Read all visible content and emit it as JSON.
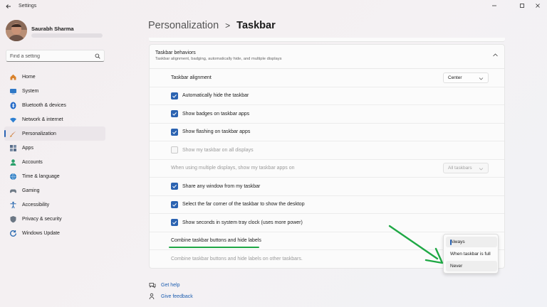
{
  "window": {
    "title": "Settings",
    "back_icon": "back-arrow-icon",
    "controls": [
      "minimize-icon",
      "maximize-icon",
      "close-icon"
    ]
  },
  "profile": {
    "name": "Saurabh Sharma"
  },
  "search": {
    "placeholder": "Find a setting",
    "icon": "search-icon"
  },
  "nav": {
    "items": [
      {
        "label": "Home",
        "icon": "home-icon",
        "color": "#d9822b"
      },
      {
        "label": "System",
        "icon": "system-icon",
        "color": "#2f78c6"
      },
      {
        "label": "Bluetooth & devices",
        "icon": "bluetooth-icon",
        "color": "#1f67c7"
      },
      {
        "label": "Network & internet",
        "icon": "wifi-icon",
        "color": "#2d7fd1"
      },
      {
        "label": "Personalization",
        "icon": "brush-icon",
        "color": "#c86a2b",
        "selected": true
      },
      {
        "label": "Apps",
        "icon": "apps-icon",
        "color": "#5a6f8a"
      },
      {
        "label": "Accounts",
        "icon": "accounts-icon",
        "color": "#2aa06b"
      },
      {
        "label": "Time & language",
        "icon": "globe-icon",
        "color": "#2f7fc4"
      },
      {
        "label": "Gaming",
        "icon": "gaming-icon",
        "color": "#6e7a86"
      },
      {
        "label": "Accessibility",
        "icon": "accessibility-icon",
        "color": "#2a6ab0"
      },
      {
        "label": "Privacy & security",
        "icon": "shield-icon",
        "color": "#6b7784"
      },
      {
        "label": "Windows Update",
        "icon": "update-icon",
        "color": "#2a6ab0"
      }
    ]
  },
  "breadcrumb": {
    "parent": "Personalization",
    "separator": ">",
    "current": "Taskbar"
  },
  "section": {
    "title": "Taskbar behaviors",
    "subtitle": "Taskbar alignment, badging, automatically hide, and multiple displays"
  },
  "settings": {
    "alignment": {
      "label": "Taskbar alignment",
      "value": "Center"
    },
    "auto_hide": {
      "label": "Automatically hide the taskbar",
      "checked": true
    },
    "badges": {
      "label": "Show badges on taskbar apps",
      "checked": true
    },
    "flashing": {
      "label": "Show flashing on taskbar apps",
      "checked": true
    },
    "all_displays": {
      "label": "Show my taskbar on all displays",
      "checked": false,
      "disabled": true
    },
    "multi_display": {
      "label": "When using multiple displays, show my taskbar apps on",
      "value": "All taskbars",
      "disabled": true
    },
    "share_window": {
      "label": "Share any window from my taskbar",
      "checked": true
    },
    "far_corner": {
      "label": "Select the far corner of the taskbar to show the desktop",
      "checked": true
    },
    "seconds": {
      "label": "Show seconds in system tray clock (uses more power)",
      "checked": true
    },
    "combine": {
      "label": "Combine taskbar buttons and hide labels"
    },
    "combine_other": {
      "label": "Combine taskbar buttons and hide labels on other taskbars.",
      "disabled": true
    }
  },
  "combine_menu": {
    "options": [
      "Always",
      "When taskbar is full",
      "Never"
    ],
    "selected": "Always",
    "hovered": "Never"
  },
  "links": {
    "help": "Get help",
    "feedback": "Give feedback"
  },
  "colors": {
    "accent": "#2b63b1",
    "annotation_green": "#1fa845",
    "link": "#1f5fb0"
  }
}
